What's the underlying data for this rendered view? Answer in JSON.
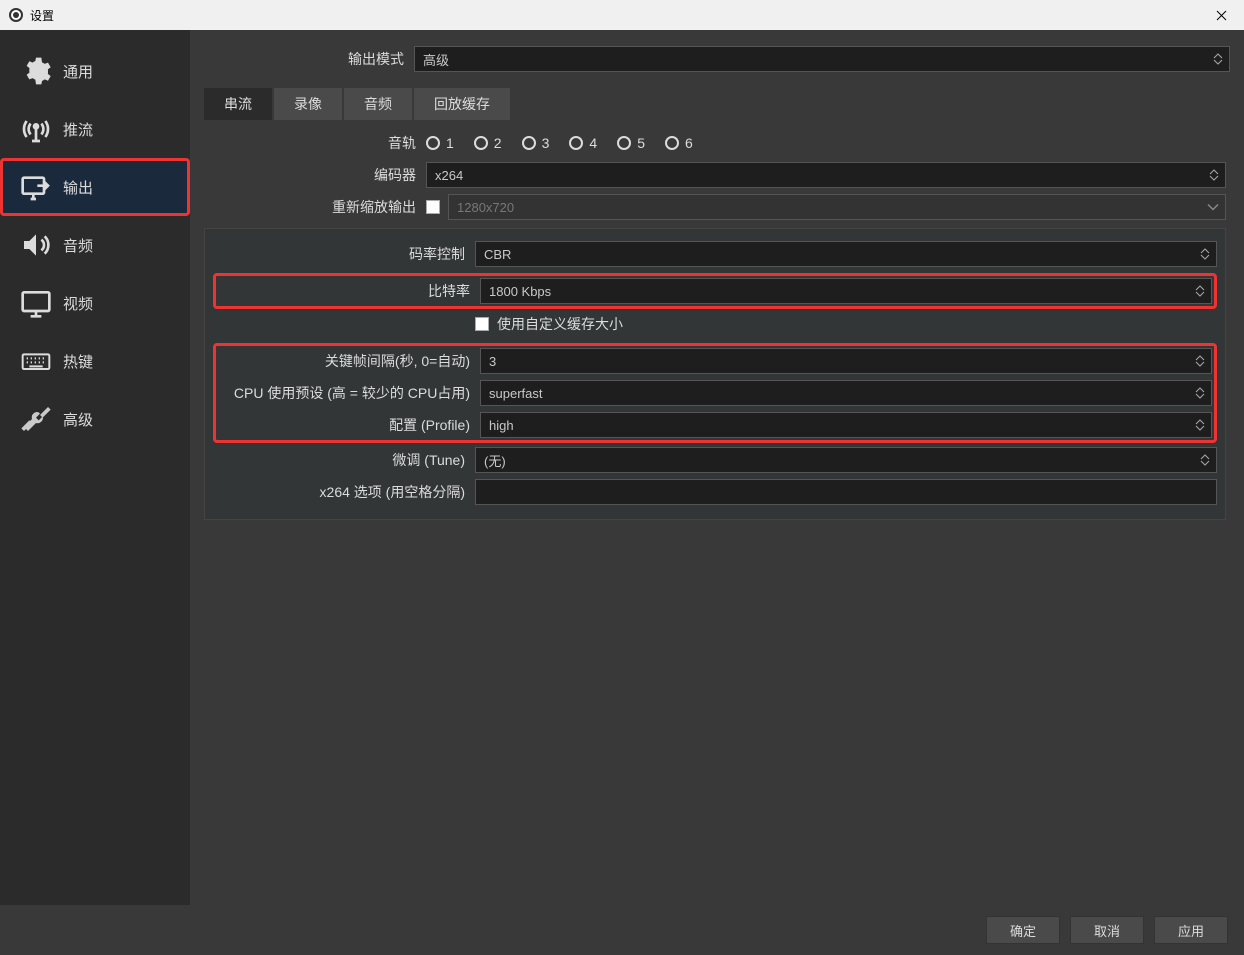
{
  "title": "设置",
  "sidebar": {
    "items": [
      {
        "label": "通用"
      },
      {
        "label": "推流"
      },
      {
        "label": "输出"
      },
      {
        "label": "音频"
      },
      {
        "label": "视频"
      },
      {
        "label": "热键"
      },
      {
        "label": "高级"
      }
    ]
  },
  "tabs": {
    "streaming": "串流",
    "recording": "录像",
    "audio": "音频",
    "replay": "回放缓存"
  },
  "labels": {
    "output_mode": "输出模式",
    "output_mode_value": "高级",
    "audio_track": "音轨",
    "encoder": "编码器",
    "encoder_value": "x264",
    "rescale": "重新缩放输出",
    "rescale_value": "1280x720",
    "rate_control": "码率控制",
    "rate_control_value": "CBR",
    "bitrate": "比特率",
    "bitrate_value": "1800 Kbps",
    "custom_buffer": "使用自定义缓存大小",
    "keyint": "关键帧间隔(秒, 0=自动)",
    "keyint_value": "3",
    "cpu_preset": "CPU 使用预设 (高 = 较少的 CPU占用)",
    "cpu_preset_value": "superfast",
    "profile": "配置 (Profile)",
    "profile_value": "high",
    "tune": "微调 (Tune)",
    "tune_value": "(无)",
    "x264opts": "x264 选项 (用空格分隔)",
    "x264opts_value": ""
  },
  "tracks": [
    "1",
    "2",
    "3",
    "4",
    "5",
    "6"
  ],
  "buttons": {
    "ok": "确定",
    "cancel": "取消",
    "apply": "应用"
  }
}
